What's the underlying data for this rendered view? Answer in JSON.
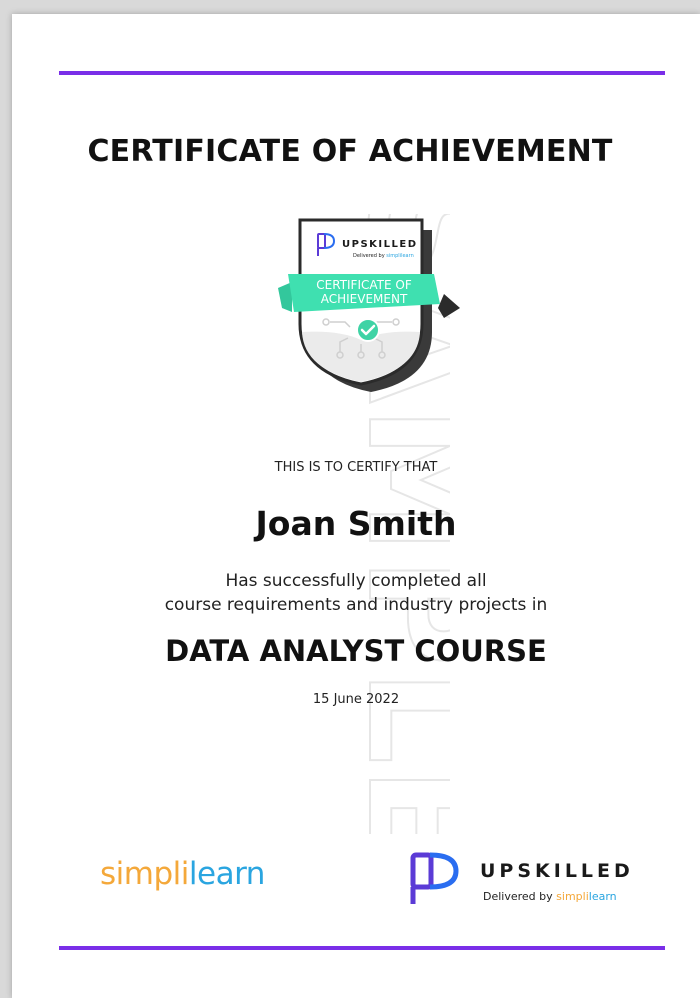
{
  "colors": {
    "accent": "#7a2ee8",
    "badge_ribbon": "#3fe0b0",
    "simpli_orange": "#f4a83a",
    "simpli_blue": "#2aa5e0",
    "upskilled_purple": "#5b3bd6",
    "upskilled_blue": "#2a6df0"
  },
  "certificate": {
    "title": "CERTIFICATE OF ACHIEVEMENT",
    "certify_text": "THIS IS TO CERTIFY THAT",
    "recipient_name": "Joan Smith",
    "completion_line1": "Has successfully completed all",
    "completion_line2": "course requirements and industry projects in",
    "course_name": "DATA ANALYST COURSE",
    "date": "15 June 2022"
  },
  "badge": {
    "brand": "UPSKILLED",
    "delivered_by": "Delivered by ",
    "delivered_brand": "simplilearn",
    "ribbon_line1": "CERTIFICATE OF",
    "ribbon_line2": "ACHIEVEMENT",
    "icon": "check-circle-icon"
  },
  "watermark": {
    "text": "SAMPLE"
  },
  "logos": {
    "simplilearn": {
      "part1": "simpl",
      "bar": "i",
      "part2": "learn"
    },
    "upskilled": {
      "name": "UPSKILLED",
      "delivered_by": "Delivered by ",
      "delivered_part1": "simpl",
      "delivered_bar": "i",
      "delivered_part2": "learn"
    }
  }
}
